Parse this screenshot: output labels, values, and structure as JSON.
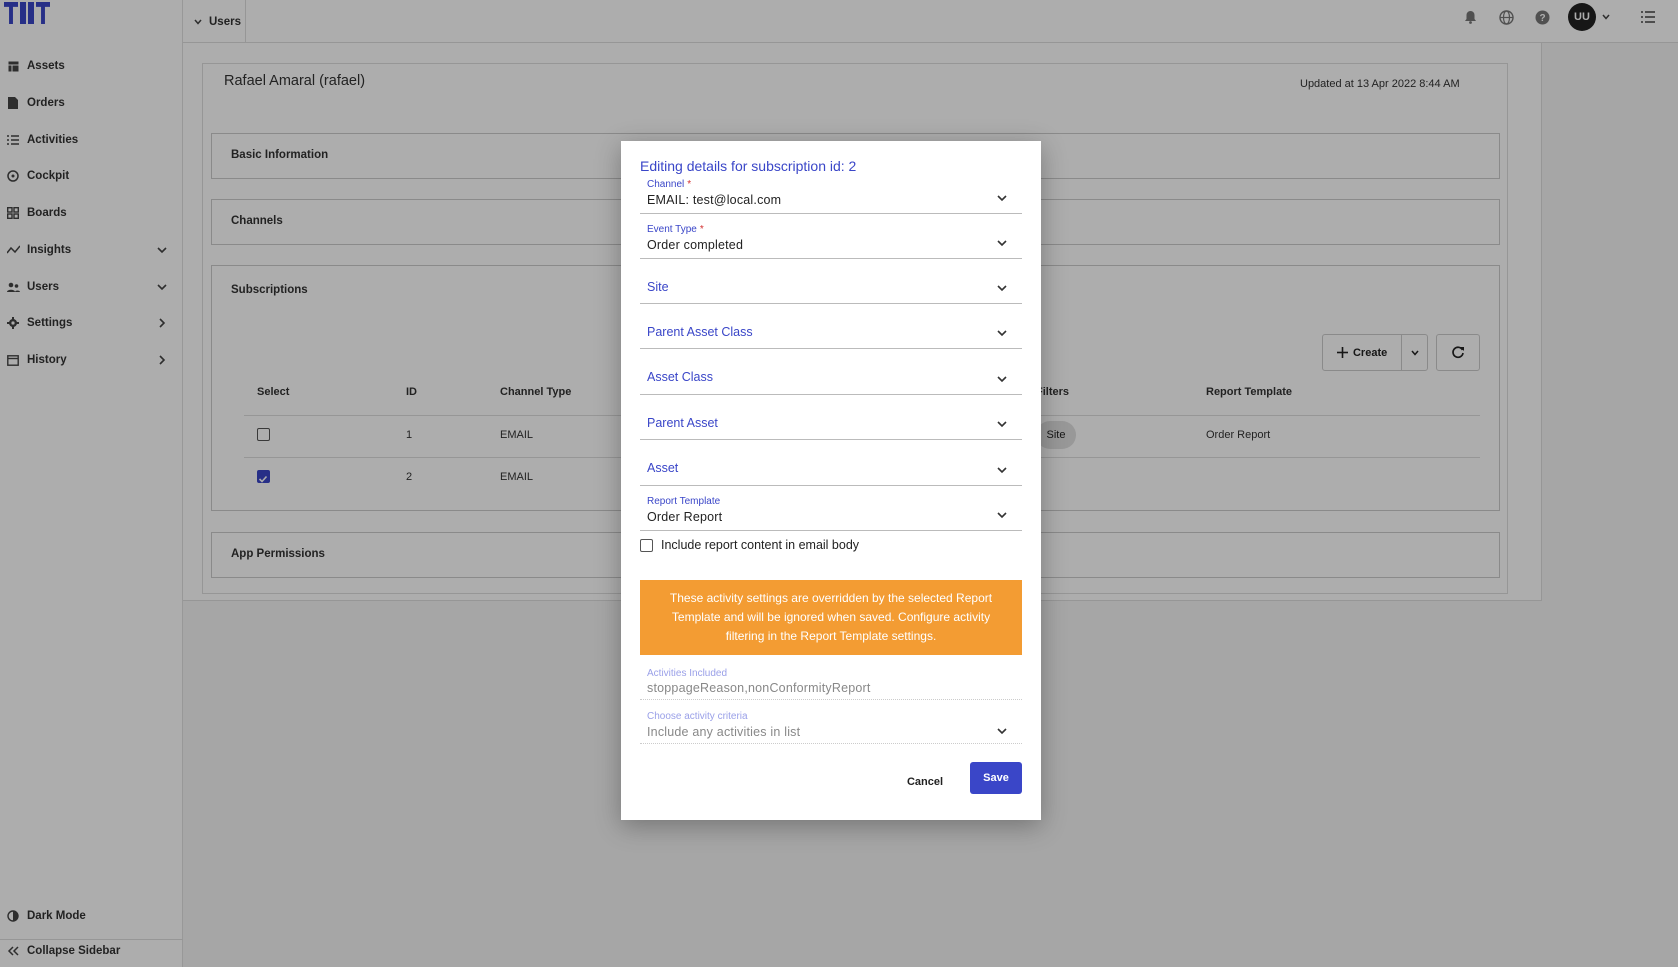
{
  "sidebar": {
    "items": [
      {
        "label": "Assets",
        "icon": "table-icon"
      },
      {
        "label": "Orders",
        "icon": "document-icon"
      },
      {
        "label": "Activities",
        "icon": "list-icon"
      },
      {
        "label": "Cockpit",
        "icon": "gauge-icon"
      },
      {
        "label": "Boards",
        "icon": "grid-icon"
      },
      {
        "label": "Insights",
        "icon": "trend-icon"
      },
      {
        "label": "Users",
        "icon": "users-icon"
      },
      {
        "label": "Settings",
        "icon": "gear-icon"
      },
      {
        "label": "History",
        "icon": "calendar-icon"
      }
    ],
    "dark_mode": "Dark Mode",
    "collapse": "Collapse Sidebar"
  },
  "topbar": {
    "breadcrumb": "Users",
    "avatar": "UU"
  },
  "page": {
    "user_name": "Rafael Amaral (rafael)",
    "updated": "Updated at 13 Apr 2022 8:44 AM",
    "sections": {
      "basic": "Basic Information",
      "channels": "Channels",
      "subscriptions": "Subscriptions",
      "permissions": "App Permissions"
    },
    "create_label": "Create",
    "table": {
      "headers": [
        "Select",
        "ID",
        "Channel Type",
        "Filters",
        "Report Template"
      ],
      "rows": [
        {
          "id": "1",
          "channel": "EMAIL",
          "filter": "Site",
          "template": "Order Report",
          "checked": false
        },
        {
          "id": "2",
          "channel": "EMAIL",
          "filter": "",
          "template": "",
          "checked": true
        }
      ]
    }
  },
  "modal": {
    "title": "Editing details for subscription id: 2",
    "channel": {
      "label": "Channel",
      "required": "*",
      "value": "EMAIL: test@local.com"
    },
    "event_type": {
      "label": "Event Type",
      "required": "*",
      "value": "Order completed"
    },
    "site": "Site",
    "parent_asset_class": "Parent Asset Class",
    "asset_class": "Asset Class",
    "parent_asset": "Parent Asset",
    "asset": "Asset",
    "report_template": {
      "label": "Report Template",
      "value": "Order Report"
    },
    "include_label": "Include report content in email body",
    "warning": "These activity settings are overridden by the selected Report Template and will be ignored when saved. Configure activity filtering in the Report Template settings.",
    "activities": {
      "label": "Activities Included",
      "value": "stoppageReason,nonConformityReport"
    },
    "criteria": {
      "label": "Choose activity criteria",
      "value": "Include any activities in list"
    },
    "cancel": "Cancel",
    "save": "Save"
  },
  "colors": {
    "accent": "#3a46c8",
    "warning": "#f39c33",
    "required": "#d32f2f"
  }
}
